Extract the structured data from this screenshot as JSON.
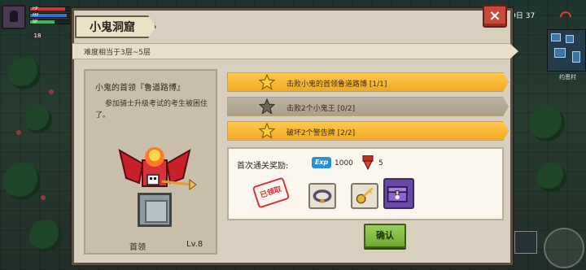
{
  "hud": {
    "hp_label": "HP",
    "mp_label": "MP",
    "sp_label": "SP",
    "level": "18",
    "time": "11月29日 37",
    "location": "约恩村",
    "hp_fraction": 0.85,
    "mp_fraction": 0.9,
    "sp_fraction": 0.6
  },
  "dialog": {
    "title": "小鬼洞窟",
    "close_symbol": "×",
    "difficulty": "难度相当于3层~5层",
    "boss": {
      "name": "小鬼的首领『鲁道路博』",
      "description": "参加骑士升级考试的考生被困住了。",
      "role": "首领",
      "level": "Lv.8"
    },
    "objectives": [
      {
        "text": "击败小鬼的首领鲁道路博 [1/1]",
        "completed": true
      },
      {
        "text": "击败2个小鬼王 [0/2]",
        "completed": false
      },
      {
        "text": "破坏2个警告牌 [2/2]",
        "completed": true
      }
    ],
    "rewards": {
      "label": "首次通关奖励:",
      "exp_icon_text": "Exp",
      "exp_value": "1000",
      "medal_value": "5",
      "claimed_stamp": "已领取",
      "items": [
        "collar-icon",
        "key-icon",
        "chest-icon"
      ]
    },
    "confirm_label": "确认"
  },
  "colors": {
    "completed_objective": "#f0aa24",
    "pending_objective": "#a99f8b",
    "confirm_button": "#7cb840",
    "close_button": "#c94a3a",
    "stamp": "#d8323a"
  }
}
